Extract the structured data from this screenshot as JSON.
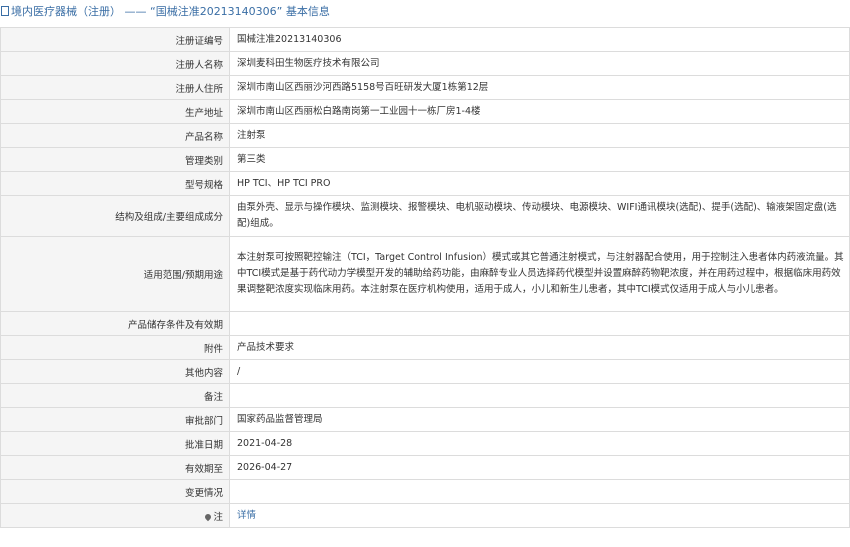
{
  "header": {
    "title": "境内医疗器械（注册） —— “国械注准20213140306” 基本信息"
  },
  "rows": [
    {
      "label": "注册证编号",
      "value": "国械注准20213140306"
    },
    {
      "label": "注册人名称",
      "value": "深圳麦科田生物医疗技术有限公司"
    },
    {
      "label": "注册人住所",
      "value": "深圳市南山区西丽沙河西路5158号百旺研发大厦1栋第12层"
    },
    {
      "label": "生产地址",
      "value": "深圳市南山区西丽松白路南岗第一工业园十一栋厂房1-4楼"
    },
    {
      "label": "产品名称",
      "value": "注射泵"
    },
    {
      "label": "管理类别",
      "value": "第三类"
    },
    {
      "label": "型号规格",
      "value": "HP TCI、HP TCI PRO"
    },
    {
      "label": "结构及组成/主要组成成分",
      "value": "由泵外壳、显示与操作模块、监测模块、报警模块、电机驱动模块、传动模块、电源模块、WIFI通讯模块(选配)、提手(选配)、输液架固定盘(选配)组成。"
    },
    {
      "label": "适用范围/预期用途",
      "value": "本注射泵可按照靶控输注（TCI，Target Control Infusion）模式或其它普通注射模式，与注射器配合使用，用于控制注入患者体内药液流量。其中TCI模式是基于药代动力学模型开发的辅助给药功能，由麻醉专业人员选择药代模型并设置麻醉药物靶浓度，并在用药过程中，根据临床用药效果调整靶浓度实现临床用药。本注射泵在医疗机构使用，适用于成人，小儿和新生儿患者，其中TCI模式仅适用于成人与小儿患者。"
    },
    {
      "label": "产品储存条件及有效期",
      "value": ""
    },
    {
      "label": "附件",
      "value": "产品技术要求"
    },
    {
      "label": "其他内容",
      "value": "/"
    },
    {
      "label": "备注",
      "value": ""
    },
    {
      "label": "审批部门",
      "value": "国家药品监督管理局"
    },
    {
      "label": "批准日期",
      "value": "2021-04-28"
    },
    {
      "label": "有效期至",
      "value": "2026-04-27"
    },
    {
      "label": "变更情况",
      "value": ""
    }
  ],
  "note": {
    "label": "注",
    "link": "详情"
  },
  "colors": {
    "accent": "#3a6ea5",
    "label_bg": "#f5f5f5",
    "border": "#dcdcdc"
  }
}
